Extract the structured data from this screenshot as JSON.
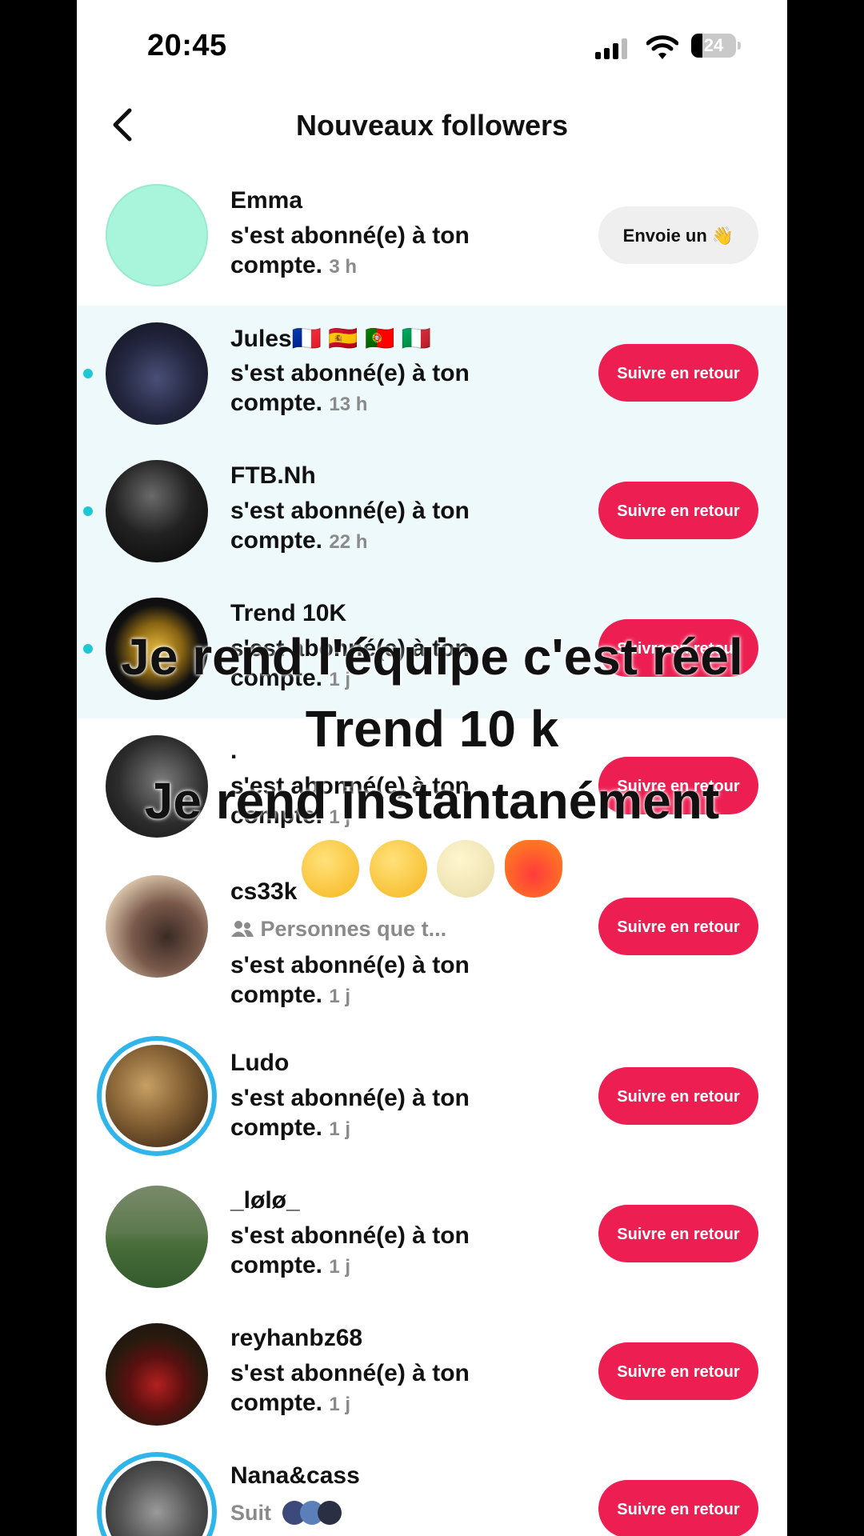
{
  "status_bar": {
    "time": "20:45",
    "battery": "24"
  },
  "header": {
    "title": "Nouveaux followers"
  },
  "followers": [
    {
      "name": "Emma",
      "message": "s'est abonné(e) à ton compte.",
      "ago": "3 h",
      "button": "Envoie un 👋",
      "unread": false
    },
    {
      "name": "Jules🇫🇷 🇪🇸 🇵🇹 🇮🇹",
      "message": "s'est abonné(e) à ton compte.",
      "ago": "13 h",
      "button": "Suivre en retour",
      "unread": true
    },
    {
      "name": "FTB.Nh",
      "message": "s'est abonné(e) à ton compte.",
      "ago": "22 h",
      "button": "Suivre en retour",
      "unread": true
    },
    {
      "name": "Trend 10K",
      "message": "s'est abonné(e) à ton compte.",
      "ago": "1 j",
      "button": "Suivre en retour",
      "unread": true
    },
    {
      "name": ".",
      "message": "s'est abonné(e) à ton compte.",
      "ago": "1 j",
      "button": "Suivre en retour",
      "unread": false
    },
    {
      "name": "cs33k",
      "subtitle": "Personnes que t...",
      "message": "s'est abonné(e) à ton compte.",
      "ago": "1 j",
      "button": "Suivre en retour",
      "unread": false
    },
    {
      "name": "Ludo",
      "message": "s'est abonné(e) à ton compte.",
      "ago": "1 j",
      "button": "Suivre en retour",
      "unread": false
    },
    {
      "name": "_lølø_",
      "message": "s'est abonné(e) à ton compte.",
      "ago": "1 j",
      "button": "Suivre en retour",
      "unread": false
    },
    {
      "name": "reyhanbz68",
      "message": "s'est abonné(e) à ton compte.",
      "ago": "1 j",
      "button": "Suivre en retour",
      "unread": false
    },
    {
      "name": "Nana&cass",
      "subtitle": "Suit",
      "button": "Suivre en retour",
      "unread": false
    }
  ],
  "overlay": {
    "line1": "Je rend l'équipe c'est réel",
    "line2": "Trend 10 k",
    "line3": "Je rend instantanément",
    "emojis": [
      "kiss-emoji",
      "grin-emoji",
      "mask-emoji",
      "heart-on-fire-emoji"
    ]
  },
  "colors": {
    "accent": "#ed1f52",
    "unread_bg": "#eef9fc",
    "unread_dot": "#1fc7d4"
  }
}
